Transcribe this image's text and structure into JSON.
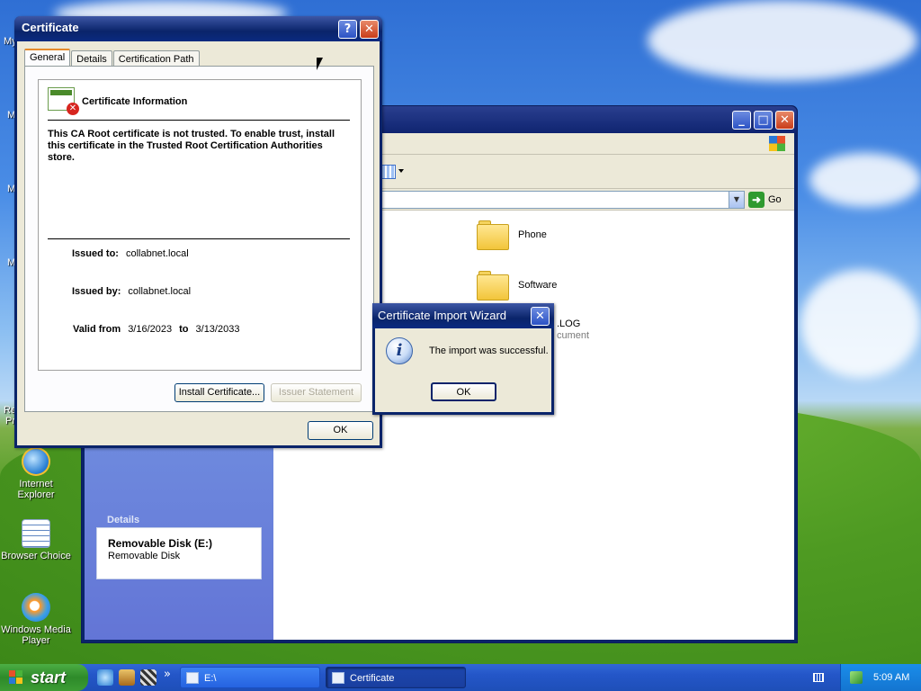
{
  "desktop": {
    "icons": [
      {
        "label": "Internet Explorer",
        "icon": "internet-explorer-icon"
      },
      {
        "label": "Browser Choice",
        "icon": "browser-choice-icon"
      },
      {
        "label": "Windows Media Player",
        "icon": "windows-media-player-icon"
      }
    ],
    "partial_labels": [
      "My",
      "M",
      "M",
      "M",
      "Re",
      "Pr"
    ]
  },
  "explorer": {
    "address_go_label": "Go",
    "details_heading": "Details",
    "details_name": "Removable Disk (E:)",
    "details_type": "Removable Disk",
    "files": [
      {
        "name": "Phone",
        "icon": "folder-icon"
      },
      {
        "name": "Software",
        "icon": "folder-icon"
      },
      {
        "name": ".LOG",
        "type": "cument",
        "icon": "document-icon"
      }
    ]
  },
  "certificate": {
    "title": "Certificate",
    "help_label": "?",
    "close_label": "✕",
    "tabs": [
      {
        "label": "General",
        "active": true
      },
      {
        "label": "Details",
        "active": false
      },
      {
        "label": "Certification Path",
        "active": false
      }
    ],
    "info_title": "Certificate Information",
    "warning_text": "This CA Root certificate is not trusted. To enable trust, install this certificate in the Trusted Root Certification Authorities store.",
    "issued_to_label": "Issued to:",
    "issued_to_value": "collabnet.local",
    "issued_by_label": "Issued by:",
    "issued_by_value": "collabnet.local",
    "valid_from_label": "Valid from",
    "valid_from_value": "3/16/2023",
    "valid_to_label": "to",
    "valid_to_value": "3/13/2033",
    "install_button": "Install Certificate...",
    "issuer_statement_button": "Issuer Statement",
    "ok_button": "OK"
  },
  "wizard": {
    "title": "Certificate Import Wizard",
    "close_label": "✕",
    "message": "The import was successful.",
    "ok_button": "OK",
    "icon": "info-icon"
  },
  "taskbar": {
    "start_label": "start",
    "tasks": [
      {
        "label": "E:\\",
        "active": false
      },
      {
        "label": "Certificate",
        "active": true
      }
    ],
    "quicklaunch_more": "»",
    "clock": "5:09 AM"
  },
  "colors": {
    "titlebar": "#0a246a",
    "taskbar": "#245edb",
    "start": "#3c9c34",
    "dialog_bg": "#ece9d8"
  }
}
